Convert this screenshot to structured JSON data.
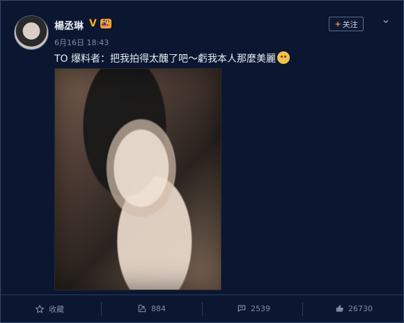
{
  "post": {
    "author_name": "楊丞琳",
    "verified_mark": "V",
    "badge_text": "🎎",
    "time": "6月16日 18:43",
    "follow_label": "关注",
    "follow_plus": "+",
    "content_text": "TO 爆料者：把我拍得太醜了吧～虧我本人那麼美麗"
  },
  "actions": {
    "favorite_label": "收藏",
    "repost_count": "884",
    "comment_count": "2539",
    "like_count": "26730"
  },
  "icons": {
    "chevron": "chevron-down-icon",
    "favorite": "star-icon",
    "repost": "repost-icon",
    "comment": "comment-icon",
    "like": "thumbs-up-icon",
    "emoji": "blush-emoji-icon"
  },
  "colors": {
    "background": "#0b1631",
    "accent": "#f7b21d",
    "muted": "#7f8ea8",
    "text": "#e6ebf3"
  }
}
